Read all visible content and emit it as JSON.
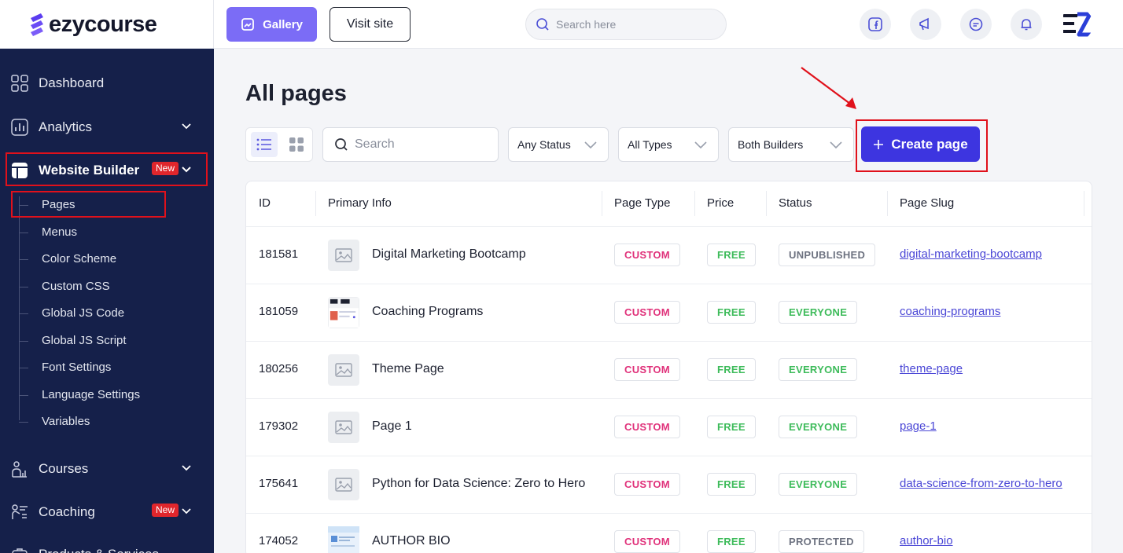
{
  "brand": {
    "name": "ezycourse"
  },
  "topbar": {
    "gallery_label": "Gallery",
    "visit_label": "Visit site",
    "search_placeholder": "Search here",
    "icons": [
      "facebook-icon",
      "megaphone-icon",
      "chat-icon",
      "bell-icon"
    ]
  },
  "sidebar": {
    "dashboard": "Dashboard",
    "analytics": "Analytics",
    "website_builder": "Website Builder",
    "new_badge": "New",
    "sub_items": [
      "Pages",
      "Menus",
      "Color Scheme",
      "Custom CSS",
      "Global JS Code",
      "Global JS Script",
      "Font Settings",
      "Language Settings",
      "Variables"
    ],
    "courses": "Courses",
    "coaching": "Coaching",
    "products": "Products & Services"
  },
  "main": {
    "title": "All pages",
    "search_placeholder": "Search",
    "filters": {
      "status": "Any Status",
      "types": "All Types",
      "builders": "Both Builders"
    },
    "create_label": "Create page"
  },
  "table": {
    "headers": {
      "id": "ID",
      "info": "Primary Info",
      "type": "Page Type",
      "price": "Price",
      "status": "Status",
      "slug": "Page Slug"
    },
    "rows": [
      {
        "id": "181581",
        "name": "Digital Marketing Bootcamp",
        "type": "CUSTOM",
        "price": "FREE",
        "status": "UNPUBLISHED",
        "slug": "digital-marketing-bootcamp"
      },
      {
        "id": "181059",
        "name": "Coaching Programs",
        "type": "CUSTOM",
        "price": "FREE",
        "status": "EVERYONE",
        "slug": "coaching-programs"
      },
      {
        "id": "180256",
        "name": "Theme Page",
        "type": "CUSTOM",
        "price": "FREE",
        "status": "EVERYONE",
        "slug": "theme-page"
      },
      {
        "id": "179302",
        "name": "Page 1",
        "type": "CUSTOM",
        "price": "FREE",
        "status": "EVERYONE",
        "slug": "page-1"
      },
      {
        "id": "175641",
        "name": "Python for Data Science: Zero to Hero",
        "type": "CUSTOM",
        "price": "FREE",
        "status": "EVERYONE",
        "slug": "data-science-from-zero-to-hero"
      },
      {
        "id": "174052",
        "name": "AUTHOR BIO",
        "type": "CUSTOM",
        "price": "FREE",
        "status": "PROTECTED",
        "slug": "author-bio"
      }
    ]
  },
  "colors": {
    "sidebar": "#15204a",
    "primary": "#3d35e0",
    "gallery": "#7b6cf6",
    "highlight": "#e0111b",
    "custom": "#e0317a",
    "free": "#3dbb5a"
  }
}
